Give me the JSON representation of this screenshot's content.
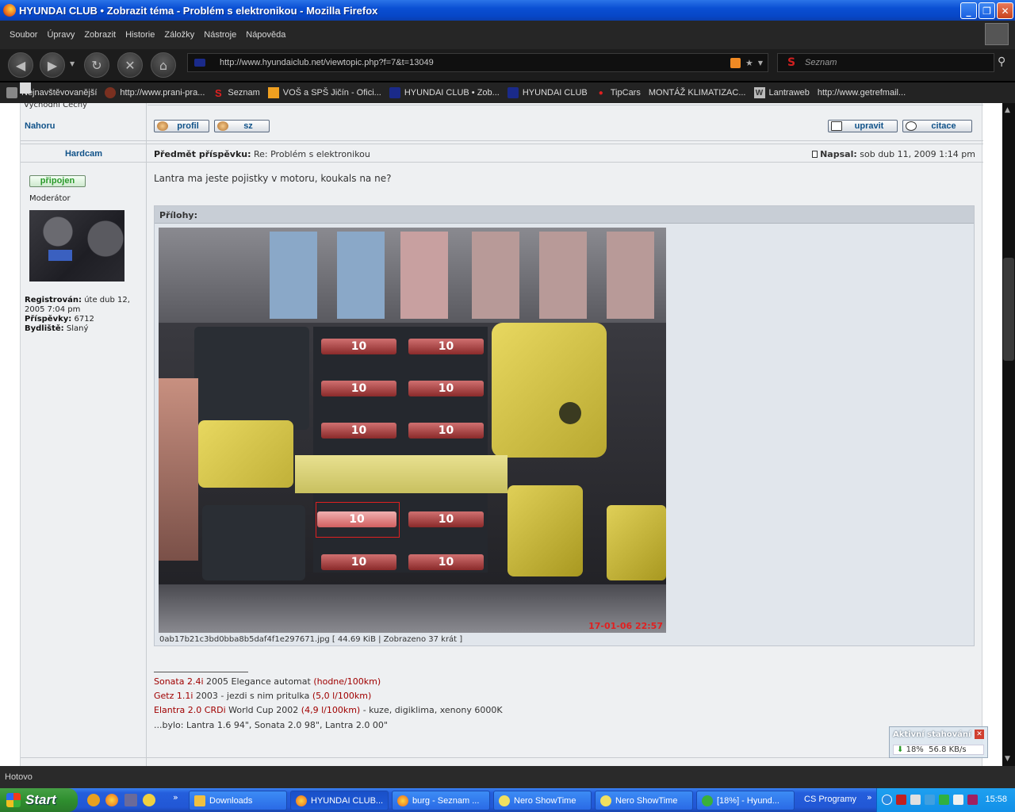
{
  "window": {
    "title": "HYUNDAI CLUB • Zobrazit téma - Problém s elektronikou - Mozilla Firefox",
    "minimize": "_",
    "maximize": "❐",
    "close": "✕"
  },
  "menu": [
    "Soubor",
    "Úpravy",
    "Zobrazit",
    "Historie",
    "Záložky",
    "Nástroje",
    "Nápověda"
  ],
  "nav": {
    "url": "http://www.hyundaiclub.net/viewtopic.php?f=7&t=13049",
    "search_placeholder": "Seznam",
    "search_engine_glyph": "S"
  },
  "bookmarks": [
    {
      "label": "Nejnavštěvovanější",
      "icon": "folder-icon"
    },
    {
      "label": "http://www.prani-pra...",
      "icon": "prani-icon"
    },
    {
      "label": "Seznam",
      "icon": "seznam-icon"
    },
    {
      "label": "VOŠ a SPŠ Jičín - Ofici...",
      "icon": "vos-icon"
    },
    {
      "label": "HYUNDAI CLUB • Zob...",
      "icon": "hyundai-icon"
    },
    {
      "label": "HYUNDAI CLUB",
      "icon": "hyundai-icon"
    },
    {
      "label": "TipCars",
      "icon": "tipcars-icon"
    },
    {
      "label": "MONTÁŽ KLIMATIZAC...",
      "icon": "page-icon"
    },
    {
      "label": "Lantraweb",
      "icon": "lantraweb-icon"
    },
    {
      "label": "http://www.getrefmail...",
      "icon": "page-icon"
    }
  ],
  "post_prev": {
    "location_tail": "Východní Čechy",
    "top_link": "Nahoru",
    "btn_profile": "profil",
    "btn_pm": "sz",
    "btn_edit": "upravit",
    "btn_quote": "citace"
  },
  "post": {
    "author": "Hardcam",
    "subject_label": "Předmět příspěvku:",
    "subject": "Re: Problém s elektronikou",
    "posted_label": "Napsal:",
    "posted": "sob dub 11, 2009 1:14 pm",
    "online_badge": "připojen",
    "rank": "Moderátor",
    "registered_label": "Registrován:",
    "registered": "úte dub 12, 2005 7:04 pm",
    "posts_label": "Příspěvky:",
    "posts": "6712",
    "location_label": "Bydliště:",
    "location": "Slaný",
    "message": "Lantra ma jeste pojistky v motoru, koukals na ne?",
    "attachments_title": "Přílohy:",
    "attachment_caption": "0ab17b21c3bd0bba8b5daf4f1e297671.jpg [ 44.69 KiB | Zobrazeno 37 krát ]",
    "photo_stamp": "17-01-06 22:57",
    "fuse_label": "10",
    "signature": [
      {
        "red": "Sonata 2.4i",
        "text": " 2005 Elegance automat ",
        "red2": "(hodne/100km)"
      },
      {
        "red": "Getz 1.1i",
        "text": " 2003 - jezdi s nim pritulka ",
        "red2": "(5,0 l/100km)"
      },
      {
        "red": "Elantra 2.0 CRDi",
        "text": " World Cup 2002 ",
        "red2": "(4,9 l/100km)",
        "tail": " - kuze, digiklima, xenony 6000K"
      },
      {
        "red": "",
        "text": "...bylo: Lantra 1.6 94\", Sonata 2.0 98\", Lantra 2.0 00\"",
        "red2": ""
      }
    ]
  },
  "download": {
    "title": "Aktivní stahování",
    "progress": "18%",
    "speed": "56.8 KB/s",
    "progress_fraction": 0.18
  },
  "status": "Hotovo",
  "taskbar": {
    "start": "Start",
    "tasks": [
      {
        "label": "Downloads",
        "active": false
      },
      {
        "label": "HYUNDAI CLUB...",
        "active": true
      },
      {
        "label": "burg - Seznam ...",
        "active": false
      },
      {
        "label": "Nero ShowTime",
        "active": false
      },
      {
        "label": "Nero ShowTime",
        "active": false
      },
      {
        "label": "[18%] - Hyund...",
        "active": false
      }
    ],
    "programs": "CS  Programy",
    "clock": "15:58"
  },
  "colors": {
    "link": "#105289",
    "signature_red": "#a00000",
    "online_green": "#2a9a2a"
  }
}
